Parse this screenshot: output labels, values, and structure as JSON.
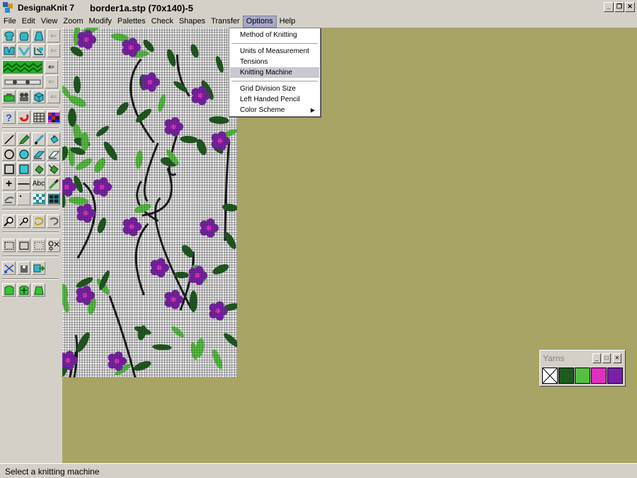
{
  "titlebar": {
    "app_name": "DesignaKnit 7",
    "document": "border1a.stp (70x140)-5"
  },
  "menubar": {
    "items": [
      "File",
      "Edit",
      "View",
      "Zoom",
      "Modify",
      "Palettes",
      "Check",
      "Shapes",
      "Transfer",
      "Options",
      "Help"
    ],
    "open": "Options"
  },
  "options_menu": {
    "items": [
      {
        "label": "Method of Knitting"
      },
      {
        "label": "Units of Measurement"
      },
      {
        "label": "Tensions"
      },
      {
        "label": "Knitting Machine",
        "selected": true
      },
      {
        "label": "Grid Division Size"
      },
      {
        "label": "Left Handed Pencil"
      },
      {
        "label": "Color Scheme",
        "submenu": true
      }
    ]
  },
  "toolbar": {
    "text_tool": "Abc",
    "help_tool": "?"
  },
  "yarns_palette": {
    "title": "Yarns",
    "colors": [
      "#ffffff",
      "#1e5a1e",
      "#55c040",
      "#e030c0",
      "#7a20a8"
    ]
  },
  "colors": {
    "workspace": "#a8a466",
    "grid_background": "#e8e8e8",
    "leaf_dark": "#1e5a1e",
    "leaf_light": "#55c040",
    "flower": "#7a20a8",
    "flower_center": "#e030c0"
  },
  "status": {
    "text": "Select a knitting machine"
  }
}
